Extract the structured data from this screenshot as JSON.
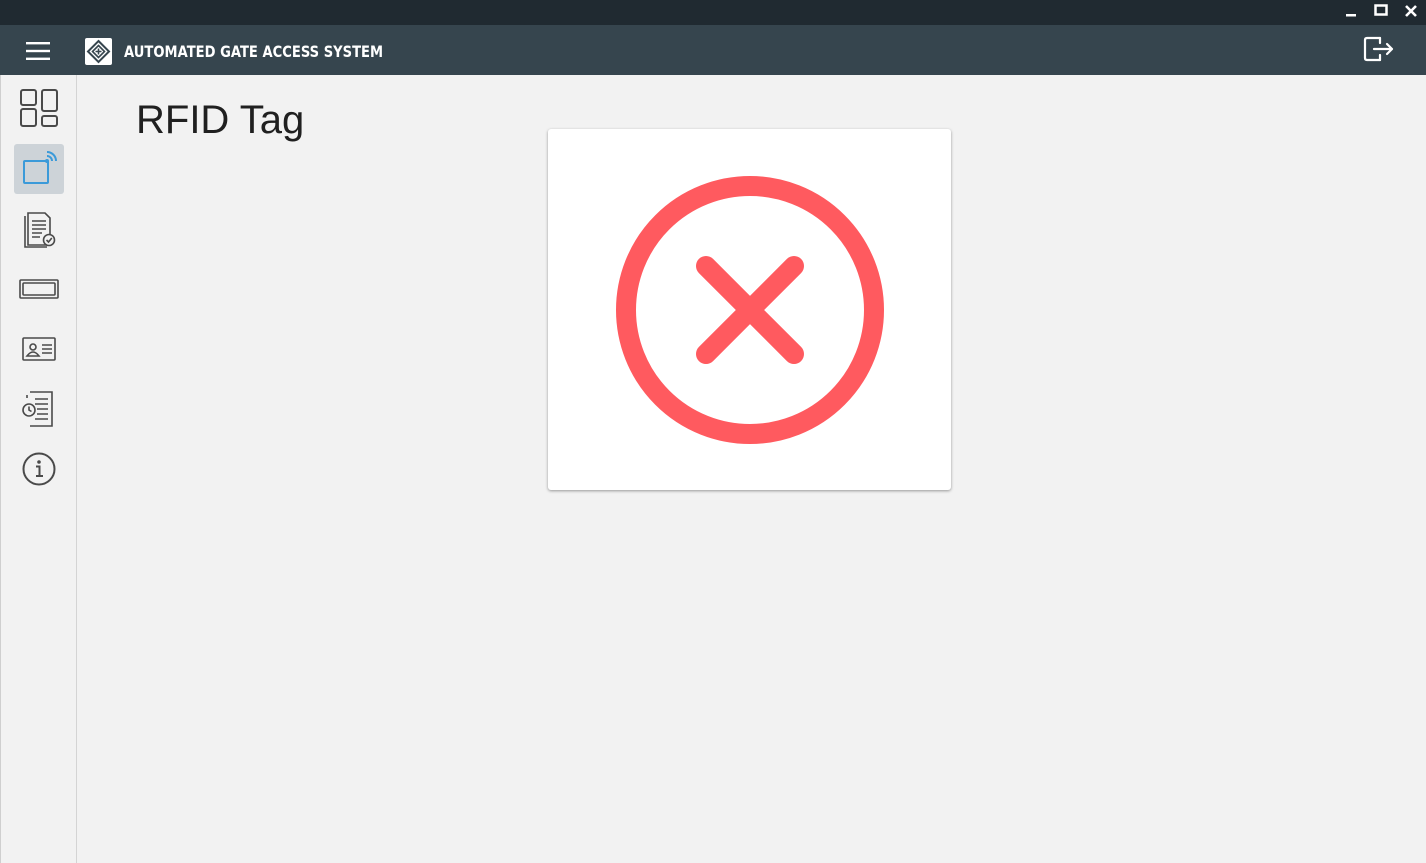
{
  "window": {
    "controls": {
      "minimize": "minimize-icon",
      "maximize": "maximize-icon",
      "close": "close-icon"
    }
  },
  "header": {
    "title": "AUTOMATED GATE ACCESS SYSTEM",
    "menu_icon": "hamburger-menu-icon",
    "logo_icon": "gate-logo-icon",
    "logout_icon": "logout-icon"
  },
  "sidebar": {
    "items": [
      {
        "id": "dashboard",
        "icon": "dashboard-icon",
        "active": false
      },
      {
        "id": "rfid-tag",
        "icon": "rfid-tag-icon",
        "active": true
      },
      {
        "id": "records",
        "icon": "document-check-icon",
        "active": false
      },
      {
        "id": "tag-card",
        "icon": "card-icon",
        "active": false
      },
      {
        "id": "id-card",
        "icon": "id-card-icon",
        "active": false
      },
      {
        "id": "logs",
        "icon": "log-history-icon",
        "active": false
      },
      {
        "id": "info",
        "icon": "info-icon",
        "active": false
      }
    ]
  },
  "main": {
    "page_title": "RFID Tag",
    "status": {
      "icon": "error-x-circle-icon",
      "color": "#ff5a5f"
    }
  },
  "colors": {
    "titlebar": "#202a31",
    "appbar": "#36454e",
    "accent": "#3b9ad9",
    "background": "#f2f2f2",
    "error": "#ff5a5f"
  }
}
